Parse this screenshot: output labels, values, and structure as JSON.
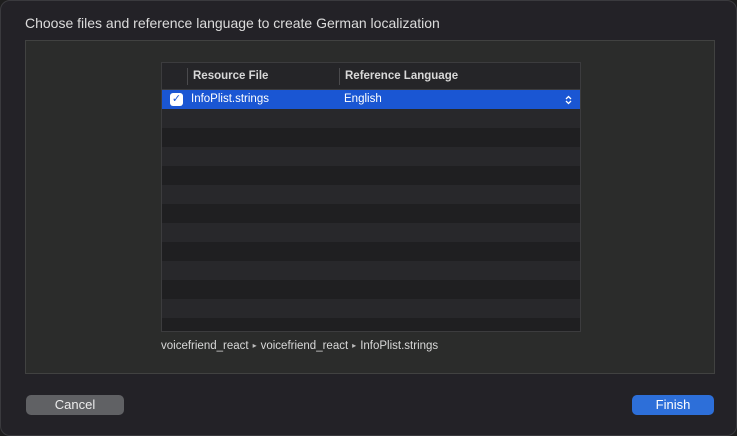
{
  "dialog": {
    "title": "Choose files and reference language to create German localization"
  },
  "table": {
    "columns": [
      "Resource File",
      "Reference Language"
    ],
    "rows": [
      {
        "checked": true,
        "file": "InfoPlist.strings",
        "language": "English"
      }
    ],
    "checkmark": "✓",
    "popup_arrows": "⌃⌄"
  },
  "path": {
    "segments": [
      "voicefriend_react",
      "voicefriend_react",
      "InfoPlist.strings"
    ],
    "separator": "▸"
  },
  "buttons": {
    "cancel": "Cancel",
    "finish": "Finish"
  },
  "colors": {
    "accent": "#2d6fd9",
    "selection": "#1a56d3"
  }
}
